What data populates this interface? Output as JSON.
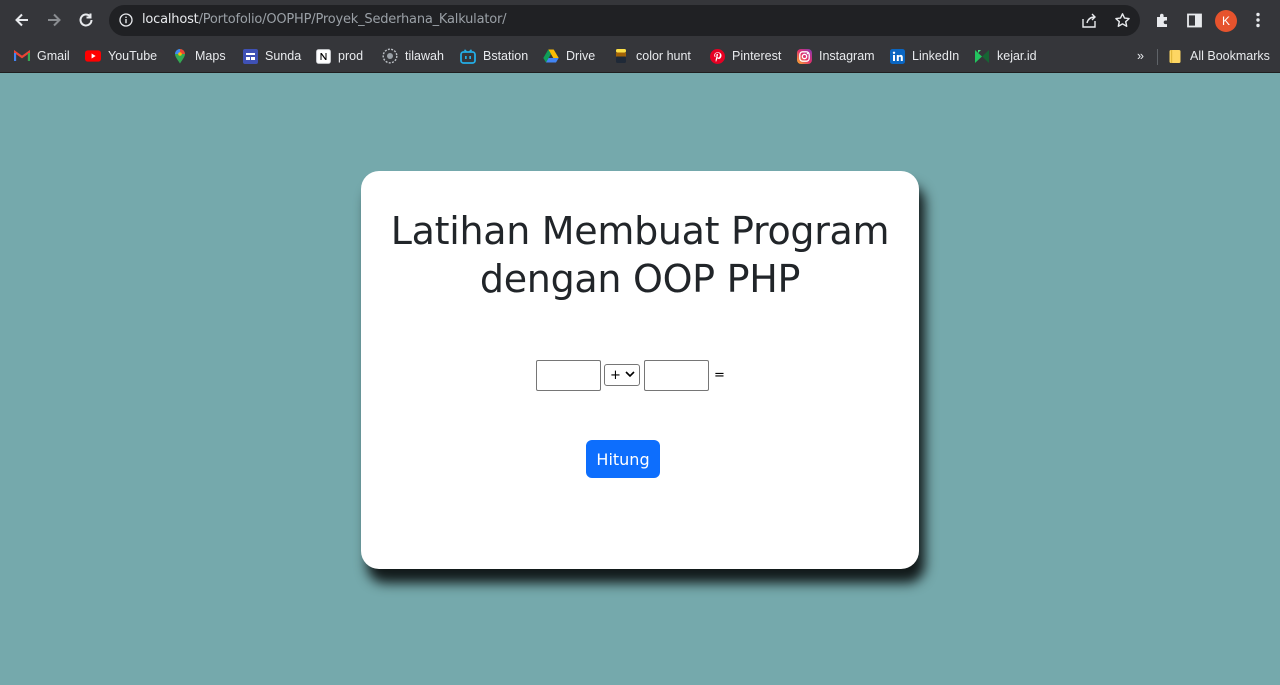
{
  "browser": {
    "url_host": "localhost",
    "url_path": "/Portofolio/OOPHP/Proyek_Sederhana_Kalkulator/",
    "profile_initial": "K",
    "bookmarks": [
      {
        "label": "Gmail",
        "icon": "gmail-icon"
      },
      {
        "label": "YouTube",
        "icon": "youtube-icon"
      },
      {
        "label": "Maps",
        "icon": "maps-icon"
      },
      {
        "label": "Sunda",
        "icon": "sunda-icon"
      },
      {
        "label": "prod",
        "icon": "notion-icon"
      },
      {
        "label": "tilawah",
        "icon": "tilawah-icon"
      },
      {
        "label": "Bstation",
        "icon": "bstation-icon"
      },
      {
        "label": "Drive",
        "icon": "drive-icon"
      },
      {
        "label": "color hunt",
        "icon": "colorhunt-icon"
      },
      {
        "label": "Pinterest",
        "icon": "pinterest-icon"
      },
      {
        "label": "Instagram",
        "icon": "instagram-icon"
      },
      {
        "label": "LinkedIn",
        "icon": "linkedin-icon"
      },
      {
        "label": "kejar.id",
        "icon": "kejar-icon"
      }
    ],
    "overflow_label": "»",
    "all_bookmarks_label": "All Bookmarks"
  },
  "page": {
    "title_line1": "Latihan Membuat Program",
    "title_line2": "dengan OOP PHP",
    "operand1_value": "",
    "operator_selected": "+",
    "operand2_value": "",
    "equals_sign": "=",
    "submit_label": "Hitung"
  },
  "colors": {
    "page_background": "#75a9ac",
    "button": "#0d6efd",
    "chrome": "#35363a"
  }
}
